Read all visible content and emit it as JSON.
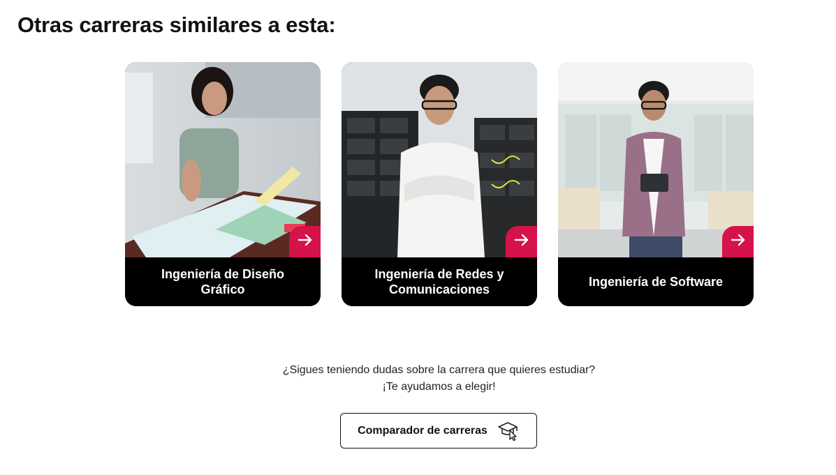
{
  "section": {
    "title": "Otras carreras similares a esta:"
  },
  "cards": [
    {
      "title": "Ingeniería de Diseño Gráfico",
      "arrow_icon": "arrow-right-icon"
    },
    {
      "title": "Ingeniería de Redes y Comunicaciones",
      "arrow_icon": "arrow-right-icon"
    },
    {
      "title": "Ingeniería de Software",
      "arrow_icon": "arrow-right-icon"
    }
  ],
  "help": {
    "line1": "¿Sigues teniendo dudas sobre la carrera que quieres estudiar?",
    "line2": "¡Te ayudamos a elegir!"
  },
  "compare_button": {
    "label": "Comparador de carreras",
    "icon": "graduation-cap-cursor-icon"
  },
  "colors": {
    "accent": "#d6124a",
    "caption_bg": "#000000",
    "caption_text": "#ffffff"
  }
}
